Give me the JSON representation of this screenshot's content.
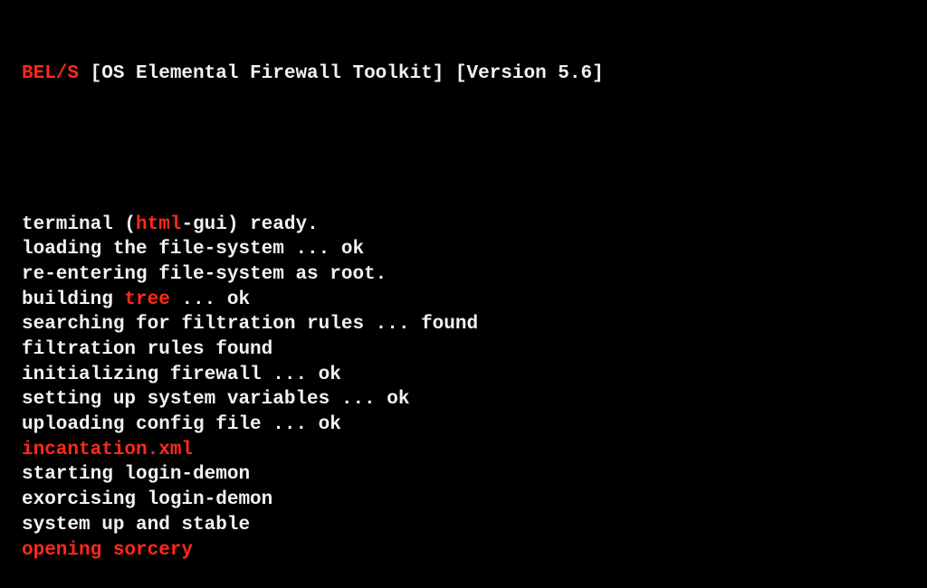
{
  "colors": {
    "background": "#000000",
    "text": "#f2f2f2",
    "highlight": "#ff2a1a"
  },
  "header": {
    "brand": "BEL/S",
    "title": " [OS Elemental Firewall Toolkit] [Version 5.6]"
  },
  "lines": [
    [
      {
        "text": "terminal (",
        "red": false
      },
      {
        "text": "html",
        "red": true
      },
      {
        "text": "-gui) ready.",
        "red": false
      }
    ],
    [
      {
        "text": "loading the file-system ... ok",
        "red": false
      }
    ],
    [
      {
        "text": "re-entering file-system as root.",
        "red": false
      }
    ],
    [
      {
        "text": "building ",
        "red": false
      },
      {
        "text": "tree",
        "red": true
      },
      {
        "text": " ... ok",
        "red": false
      }
    ],
    [
      {
        "text": "searching for filtration rules ... found",
        "red": false
      }
    ],
    [
      {
        "text": "filtration rules found",
        "red": false
      }
    ],
    [
      {
        "text": "initializing firewall ... ok",
        "red": false
      }
    ],
    [
      {
        "text": "setting up system variables ... ok",
        "red": false
      }
    ],
    [
      {
        "text": "uploading config file ... ok",
        "red": false
      }
    ],
    [
      {
        "text": "incantation.xml",
        "red": true
      }
    ],
    [
      {
        "text": "starting login-demon",
        "red": false
      }
    ],
    [
      {
        "text": "exorcising login-demon",
        "red": false
      }
    ],
    [
      {
        "text": "system up and stable",
        "red": false
      }
    ],
    [
      {
        "text": "opening sorcery",
        "red": true
      }
    ]
  ]
}
